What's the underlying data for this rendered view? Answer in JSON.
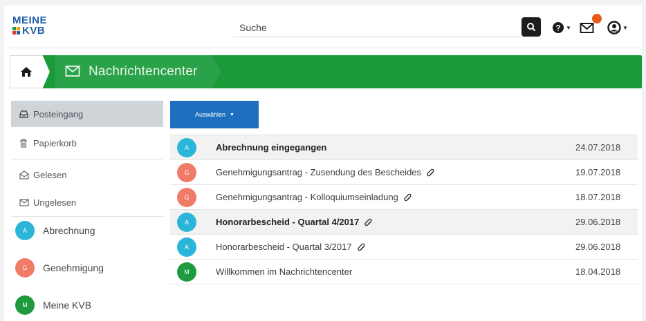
{
  "header": {
    "logo_line1": "MEINE",
    "logo_line2": "KVB",
    "search_placeholder": "Suche",
    "notification_badge": ""
  },
  "breadcrumb": {
    "current": "Nachrichtencenter"
  },
  "sidebar": {
    "folders": [
      {
        "label": "Posteingang",
        "icon": "inbox-icon",
        "active": true
      },
      {
        "label": "Papierkorb",
        "icon": "trash-icon",
        "active": false
      }
    ],
    "filters": [
      {
        "label": "Gelesen",
        "icon": "envelope-open-icon"
      },
      {
        "label": "Ungelesen",
        "icon": "envelope-icon"
      }
    ],
    "categories": [
      {
        "label": "Abrechnung",
        "letter": "A",
        "color": "#2bb5d8"
      },
      {
        "label": "Genehmigung",
        "letter": "G",
        "color": "#f07c68"
      },
      {
        "label": "Meine KVB",
        "letter": "M",
        "color": "#1f9a3e"
      }
    ]
  },
  "toolbar": {
    "select_label": "Auswählen"
  },
  "messages": [
    {
      "letter": "A",
      "color": "#2bb5d8",
      "subject": "Abrechnung eingegangen",
      "date": "24.07.2018",
      "unread": true,
      "attachment": false
    },
    {
      "letter": "G",
      "color": "#f07c68",
      "subject": "Genehmigungsantrag - Zusendung des Bescheides",
      "date": "19.07.2018",
      "unread": false,
      "attachment": true
    },
    {
      "letter": "G",
      "color": "#f07c68",
      "subject": "Genehmigungsantrag - Kolloquiumseinladung",
      "date": "18.07.2018",
      "unread": false,
      "attachment": true
    },
    {
      "letter": "A",
      "color": "#2bb5d8",
      "subject": "Honorarbescheid - Quartal 4/2017",
      "date": "29.06.2018",
      "unread": true,
      "attachment": true
    },
    {
      "letter": "A",
      "color": "#2bb5d8",
      "subject": "Honorarbescheid - Quartal 3/2017",
      "date": "29.06.2018",
      "unread": false,
      "attachment": true
    },
    {
      "letter": "M",
      "color": "#1f9a3e",
      "subject": "Willkommen im Nachrichtencenter",
      "date": "18.04.2018",
      "unread": false,
      "attachment": false
    }
  ],
  "colors": {
    "brand_green": "#1b9a3a",
    "brand_blue": "#1f6fc0",
    "logo_blue": "#1f5ea8"
  }
}
